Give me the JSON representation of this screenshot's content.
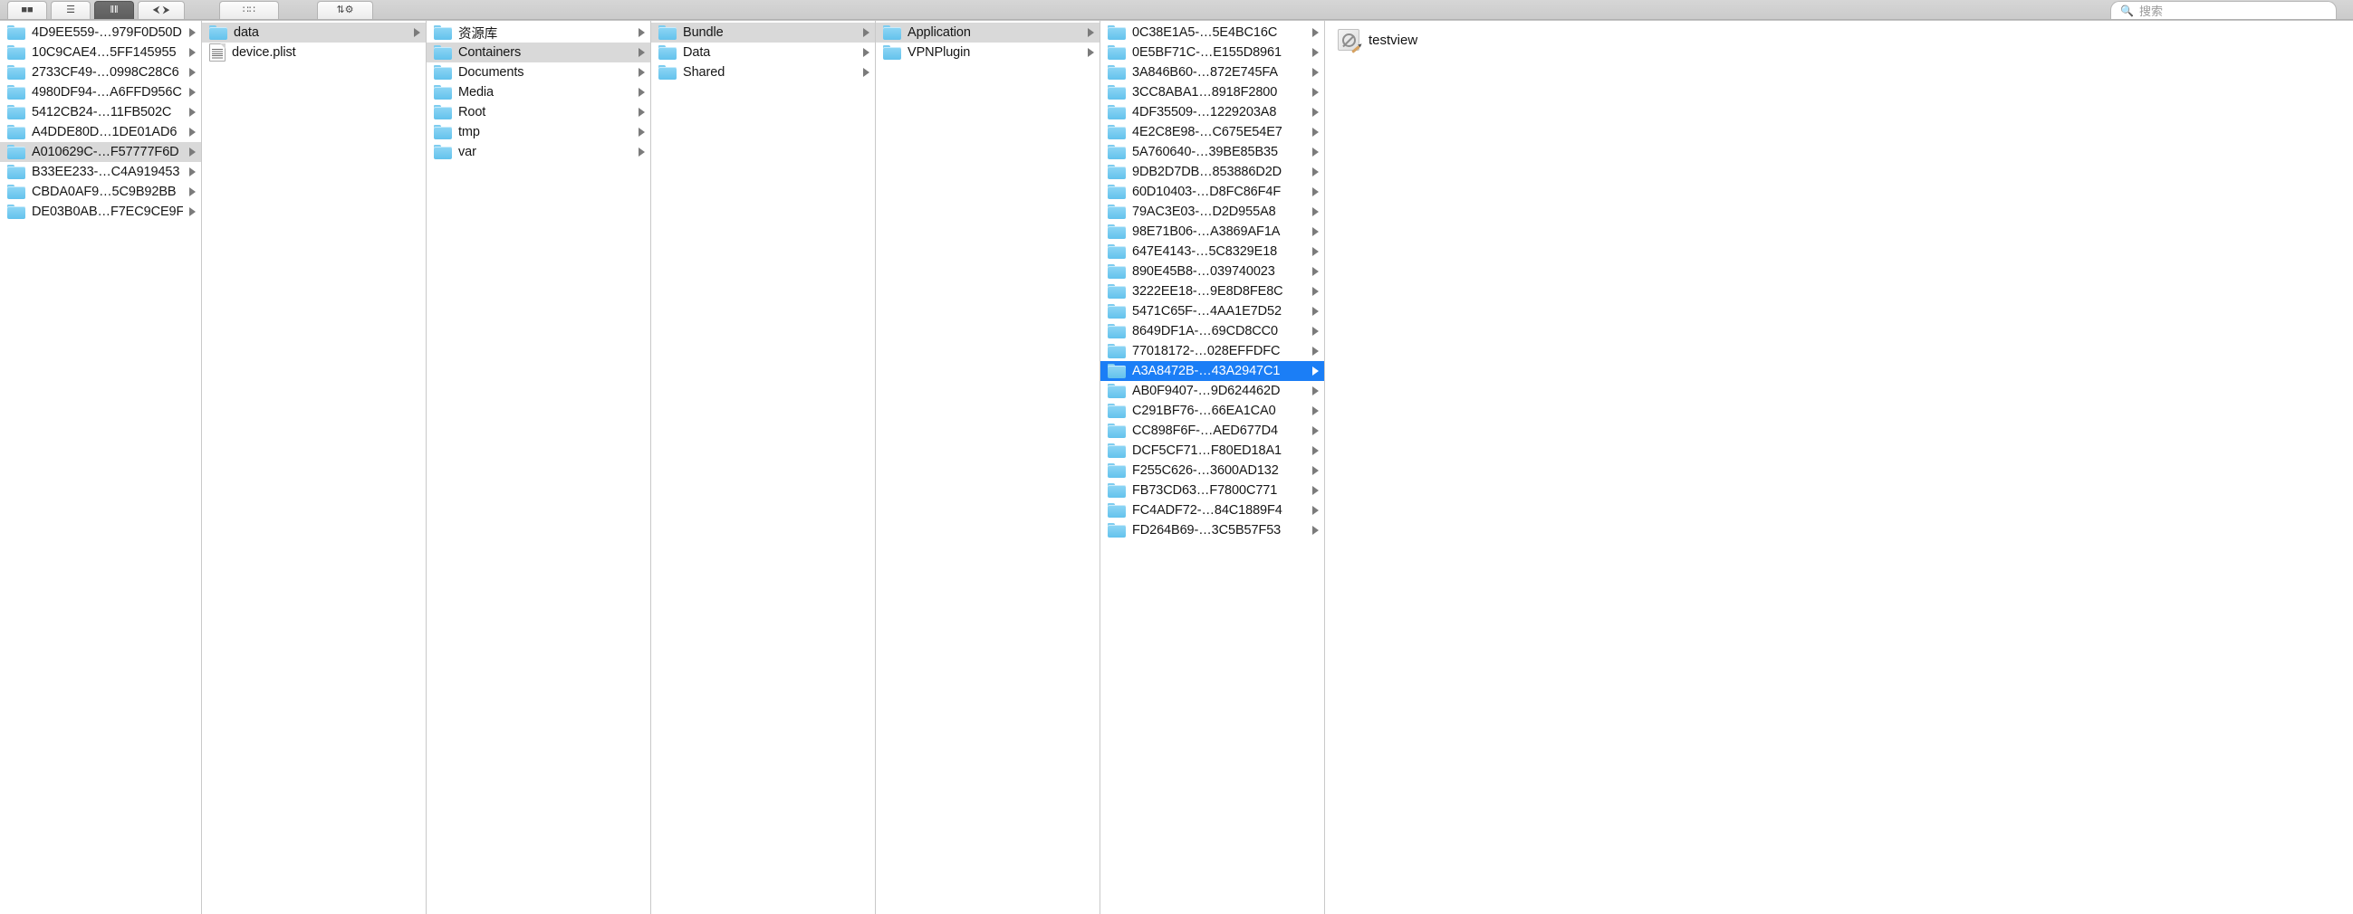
{
  "toolbar": {
    "buttons": [
      {
        "name": "icon-view-button",
        "glyph": "■■",
        "width": 44,
        "active": false
      },
      {
        "name": "list-view-button",
        "glyph": "☰",
        "width": 44,
        "active": false
      },
      {
        "name": "column-view-button",
        "glyph": "‖‖",
        "width": 44,
        "active": true
      },
      {
        "name": "coverflow-view-button",
        "glyph": "⮜ ⮞",
        "width": 52,
        "active": false
      },
      {
        "name": "arrange-button",
        "glyph": "∷∷",
        "width": 66,
        "active": false
      },
      {
        "name": "action-button",
        "glyph": "⇅⚙",
        "width": 62,
        "active": false
      }
    ],
    "search": {
      "icon": "search-icon",
      "placeholder": "搜索"
    }
  },
  "columns": [
    {
      "name": "column-devices",
      "items": [
        {
          "label": "4D9EE559-…979F0D50D",
          "type": "folder",
          "arrow": true,
          "state": "none"
        },
        {
          "label": "10C9CAE4…5FF145955",
          "type": "folder",
          "arrow": true,
          "state": "none"
        },
        {
          "label": "2733CF49-…0998C28C6",
          "type": "folder",
          "arrow": true,
          "state": "none"
        },
        {
          "label": "4980DF94-…A6FFD956C",
          "type": "folder",
          "arrow": true,
          "state": "none"
        },
        {
          "label": "5412CB24-…11FB502C",
          "type": "folder",
          "arrow": true,
          "state": "none"
        },
        {
          "label": "A4DDE80D…1DE01AD6",
          "type": "folder",
          "arrow": true,
          "state": "none"
        },
        {
          "label": "A010629C-…F57777F6D",
          "type": "folder",
          "arrow": true,
          "state": "selected-inactive"
        },
        {
          "label": "B33EE233-…C4A919453",
          "type": "folder",
          "arrow": true,
          "state": "none"
        },
        {
          "label": "CBDA0AF9…5C9B92BB",
          "type": "folder",
          "arrow": true,
          "state": "none"
        },
        {
          "label": "DE03B0AB…F7EC9CE9F",
          "type": "folder",
          "arrow": true,
          "state": "none"
        }
      ]
    },
    {
      "name": "column-device-root",
      "items": [
        {
          "label": "data",
          "type": "folder",
          "arrow": true,
          "state": "selected-inactive"
        },
        {
          "label": "device.plist",
          "type": "document",
          "arrow": false,
          "state": "none"
        }
      ]
    },
    {
      "name": "column-data",
      "items": [
        {
          "label": "资源库",
          "type": "folder",
          "arrow": true,
          "state": "none"
        },
        {
          "label": "Containers",
          "type": "folder",
          "arrow": true,
          "state": "selected-inactive"
        },
        {
          "label": "Documents",
          "type": "folder",
          "arrow": true,
          "state": "none"
        },
        {
          "label": "Media",
          "type": "folder",
          "arrow": true,
          "state": "none"
        },
        {
          "label": "Root",
          "type": "folder",
          "arrow": true,
          "state": "none"
        },
        {
          "label": "tmp",
          "type": "folder",
          "arrow": true,
          "state": "none"
        },
        {
          "label": "var",
          "type": "folder",
          "arrow": true,
          "state": "none"
        }
      ]
    },
    {
      "name": "column-containers",
      "items": [
        {
          "label": "Bundle",
          "type": "folder",
          "arrow": true,
          "state": "selected-inactive"
        },
        {
          "label": "Data",
          "type": "folder",
          "arrow": true,
          "state": "none"
        },
        {
          "label": "Shared",
          "type": "folder",
          "arrow": true,
          "state": "none"
        }
      ]
    },
    {
      "name": "column-bundle",
      "items": [
        {
          "label": "Application",
          "type": "folder",
          "arrow": true,
          "state": "selected-inactive"
        },
        {
          "label": "VPNPlugin",
          "type": "folder",
          "arrow": true,
          "state": "none"
        }
      ]
    },
    {
      "name": "column-application",
      "items": [
        {
          "label": "0C38E1A5-…5E4BC16C",
          "type": "folder",
          "arrow": true,
          "state": "none"
        },
        {
          "label": "0E5BF71C-…E155D8961",
          "type": "folder",
          "arrow": true,
          "state": "none"
        },
        {
          "label": "3A846B60-…872E745FA",
          "type": "folder",
          "arrow": true,
          "state": "none"
        },
        {
          "label": "3CC8ABA1…8918F2800",
          "type": "folder",
          "arrow": true,
          "state": "none"
        },
        {
          "label": "4DF35509-…1229203A8",
          "type": "folder",
          "arrow": true,
          "state": "none"
        },
        {
          "label": "4E2C8E98-…C675E54E7",
          "type": "folder",
          "arrow": true,
          "state": "none"
        },
        {
          "label": "5A760640-…39BE85B35",
          "type": "folder",
          "arrow": true,
          "state": "none"
        },
        {
          "label": "9DB2D7DB…853886D2D",
          "type": "folder",
          "arrow": true,
          "state": "none"
        },
        {
          "label": "60D10403-…D8FC86F4F",
          "type": "folder",
          "arrow": true,
          "state": "none"
        },
        {
          "label": "79AC3E03-…D2D955A8",
          "type": "folder",
          "arrow": true,
          "state": "none"
        },
        {
          "label": "98E71B06-…A3869AF1A",
          "type": "folder",
          "arrow": true,
          "state": "none"
        },
        {
          "label": "647E4143-…5C8329E18",
          "type": "folder",
          "arrow": true,
          "state": "none"
        },
        {
          "label": "890E45B8-…039740023",
          "type": "folder",
          "arrow": true,
          "state": "none"
        },
        {
          "label": "3222EE18-…9E8D8FE8C",
          "type": "folder",
          "arrow": true,
          "state": "none"
        },
        {
          "label": "5471C65F-…4AA1E7D52",
          "type": "folder",
          "arrow": true,
          "state": "none"
        },
        {
          "label": "8649DF1A-…69CD8CC0",
          "type": "folder",
          "arrow": true,
          "state": "none"
        },
        {
          "label": "77018172-…028EFFDFC",
          "type": "folder",
          "arrow": true,
          "state": "none"
        },
        {
          "label": "A3A8472B-…43A2947C1",
          "type": "folder",
          "arrow": true,
          "state": "selected-active"
        },
        {
          "label": "AB0F9407-…9D624462D",
          "type": "folder",
          "arrow": true,
          "state": "none"
        },
        {
          "label": "C291BF76-…66EA1CA0",
          "type": "folder",
          "arrow": true,
          "state": "none"
        },
        {
          "label": "CC898F6F-…AED677D4",
          "type": "folder",
          "arrow": true,
          "state": "none"
        },
        {
          "label": "DCF5CF71…F80ED18A1",
          "type": "folder",
          "arrow": true,
          "state": "none"
        },
        {
          "label": "F255C626-…3600AD132",
          "type": "folder",
          "arrow": true,
          "state": "none"
        },
        {
          "label": "FB73CD63…F7800C771",
          "type": "folder",
          "arrow": true,
          "state": "none"
        },
        {
          "label": "FC4ADF72-…84C1889F4",
          "type": "folder",
          "arrow": true,
          "state": "none"
        },
        {
          "label": "FD264B69-…3C5B57F53",
          "type": "folder",
          "arrow": true,
          "state": "none"
        }
      ]
    }
  ],
  "preview": {
    "name": "preview-column",
    "icon": "no-preview-icon",
    "label": "testview"
  },
  "colors": {
    "selection_active": "#1b7ef6",
    "selection_inactive": "#d9d9d9",
    "folder_blue": "#63c2ec",
    "text": "#161616"
  }
}
